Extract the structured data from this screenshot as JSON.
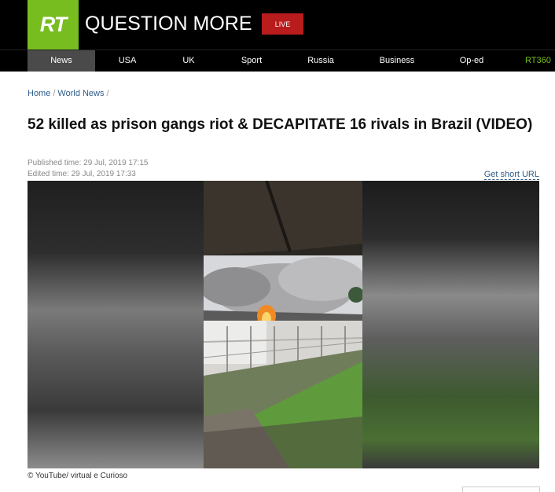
{
  "header": {
    "logo_text": "RT",
    "tagline": "QUESTION MORE",
    "live_label": "LIVE"
  },
  "nav": {
    "items": [
      {
        "label": "News"
      },
      {
        "label": "USA"
      },
      {
        "label": "UK"
      },
      {
        "label": "Sport"
      },
      {
        "label": "Russia"
      },
      {
        "label": "Business"
      },
      {
        "label": "Op-ed"
      },
      {
        "label": "RT360"
      }
    ]
  },
  "breadcrumb": {
    "home": "Home",
    "section": "World News",
    "separator": "/"
  },
  "article": {
    "title": "52 killed as prison gangs riot & DECAPITATE 16 rivals in Brazil (VIDEO)",
    "published": "Published time: 29 Jul, 2019 17:15",
    "edited": "Edited time: 29 Jul, 2019 17:33",
    "short_url_label": "Get short URL",
    "image_caption": "© YouTube/ virtual e Curioso"
  },
  "colors": {
    "brand_green": "#77bd1f",
    "live_red": "#b91c1c",
    "link_blue": "#2d5c88"
  }
}
